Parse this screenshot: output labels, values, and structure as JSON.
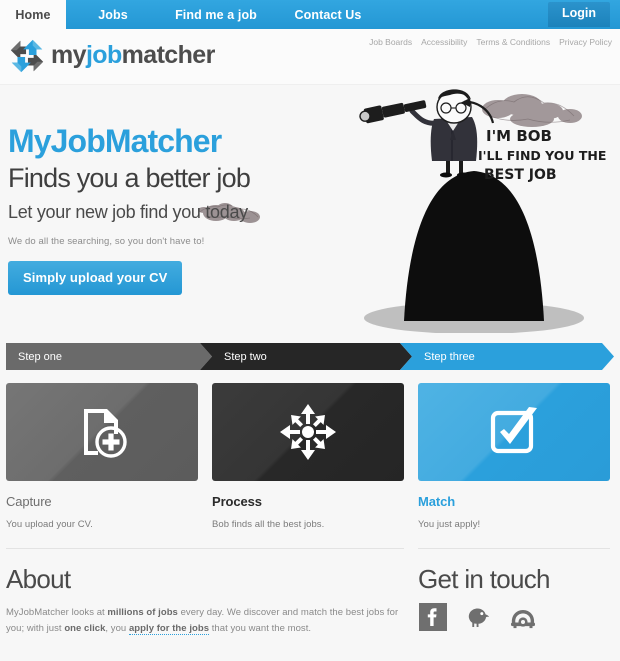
{
  "nav": {
    "items": [
      {
        "label": "Home",
        "active": true
      },
      {
        "label": "Jobs",
        "active": false
      },
      {
        "label": "Find me a job",
        "active": false
      },
      {
        "label": "Contact Us",
        "active": false
      }
    ],
    "login_label": "Login"
  },
  "header": {
    "logo": {
      "part1": "my",
      "part2": "job",
      "part3": "matcher",
      "mark_icon": "pinwheel-arrows-icon"
    },
    "utility_links": [
      "Job Boards",
      "Accessibility",
      "Terms & Conditions",
      "Privacy Policy"
    ]
  },
  "hero": {
    "title": "MyJobMatcher",
    "subtitle": "Finds you a better job",
    "tagline": "Let your new job find you today",
    "small_text": "We do all the searching, so you don't have to!",
    "cta_label": "Simply upload your CV",
    "illustration": {
      "name": "bob-with-telescope-on-hill-illustration",
      "speech_line1": "I'M BOB",
      "speech_line2": "I'LL FIND YOU THE",
      "speech_line3": "BEST JOB"
    }
  },
  "steps": [
    {
      "label": "Step one",
      "color": "#6a6a6a"
    },
    {
      "label": "Step two",
      "color": "#262626"
    },
    {
      "label": "Step three",
      "color": "#2ba0dc"
    }
  ],
  "cards": [
    {
      "title": "Capture",
      "description": "You upload your CV.",
      "icon": "document-add-icon",
      "tile_color": "#6d6d6d"
    },
    {
      "title": "Process",
      "description": "Bob finds all the best jobs.",
      "icon": "expand-arrows-icon",
      "tile_color": "#303030"
    },
    {
      "title": "Match",
      "description": "You just apply!",
      "icon": "checkbox-check-icon",
      "tile_color": "#2ba0dc"
    }
  ],
  "footer": {
    "about": {
      "heading": "About",
      "text_1": "MyJobMatcher looks at ",
      "bold_1": "millions of jobs",
      "text_2": " every day. We discover and match the best jobs for you; with just ",
      "bold_2": "one click",
      "text_3": ", you ",
      "link": "apply for the jobs",
      "text_4": " that you want the most."
    },
    "contact": {
      "heading": "Get in touch",
      "socials": [
        {
          "name": "facebook-icon"
        },
        {
          "name": "twitter-bird-icon"
        },
        {
          "name": "telephone-icon"
        }
      ]
    }
  },
  "colors": {
    "brand_blue": "#2ba0dc",
    "dark": "#262626",
    "gray": "#6a6a6a",
    "page_bg": "#f7f7f7"
  }
}
